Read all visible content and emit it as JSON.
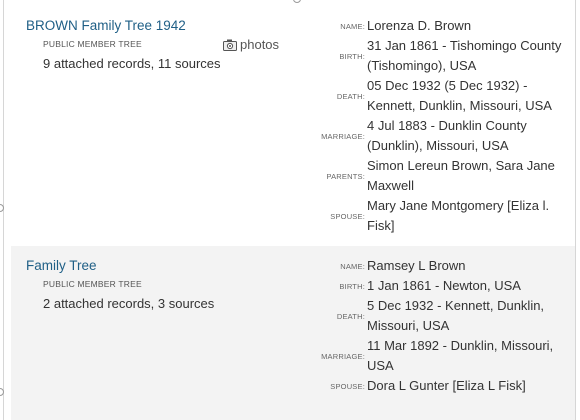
{
  "results": [
    {
      "tree_name": "BROWN Family Tree 1942",
      "tree_type": "PUBLIC MEMBER TREE",
      "counts": "9 attached records, 11 sources",
      "photos_label": "photos",
      "facts": [
        {
          "label": "NAME:",
          "value": "Lorenza D. Brown"
        },
        {
          "label": "BIRTH:",
          "value": "31 Jan 1861 - Tishomingo County (Tishomingo), USA"
        },
        {
          "label": "DEATH:",
          "value": "05 Dec 1932 (5 Dec 1932) - Kennett, Dunklin, Missouri, USA"
        },
        {
          "label": "MARRIAGE:",
          "value": "4 Jul 1883 - Dunklin County (Dunklin), Missouri, USA"
        },
        {
          "label": "PARENTS:",
          "value": "Simon Lereun Brown, Sara Jane Maxwell"
        },
        {
          "label": "SPOUSE:",
          "value": "Mary Jane Montgomery [Eliza l. Fisk]"
        }
      ]
    },
    {
      "tree_name": "Family Tree",
      "tree_type": "PUBLIC MEMBER TREE",
      "counts": "2 attached records, 3 sources",
      "facts": [
        {
          "label": "NAME:",
          "value": "Ramsey L Brown"
        },
        {
          "label": "BIRTH:",
          "value": "1 Jan 1861 - Newton, USA"
        },
        {
          "label": "DEATH:",
          "value": "5 Dec 1932 - Kennett, Dunklin, Missouri, USA"
        },
        {
          "label": "MARRIAGE:",
          "value": "11 Mar 1892 - Dunklin, Missouri, USA"
        },
        {
          "label": "SPOUSE:",
          "value": "Dora L Gunter [Eliza L Fisk]"
        }
      ]
    }
  ],
  "colors": {
    "link": "#1f5f86",
    "alt_row_bg": "#f3f3f3"
  },
  "icons": {
    "photos": "camera-icon"
  }
}
